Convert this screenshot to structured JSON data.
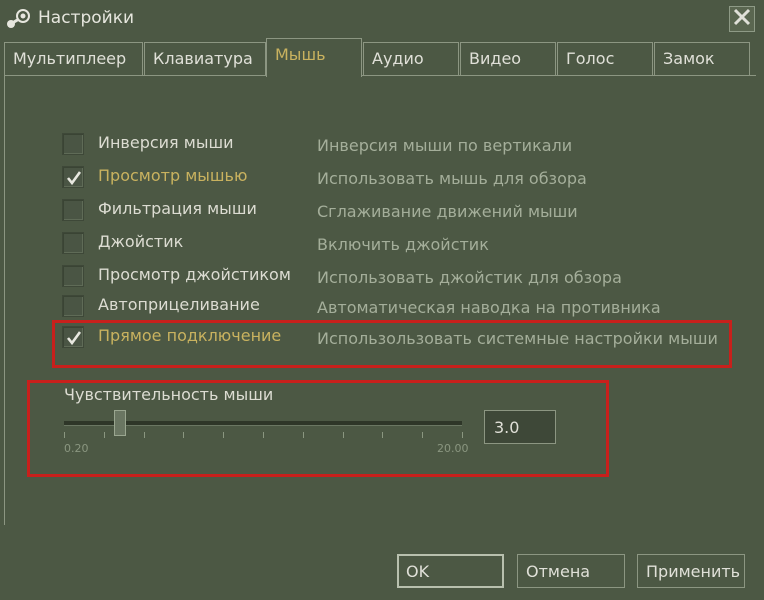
{
  "window": {
    "title": "Настройки",
    "title_icon": "steam-icon",
    "close_icon": "close-icon"
  },
  "tabs": [
    {
      "label": "Мультиплеер",
      "active": false
    },
    {
      "label": "Клавиатура",
      "active": false
    },
    {
      "label": "Мышь",
      "active": true
    },
    {
      "label": "Аудио",
      "active": false
    },
    {
      "label": "Видео",
      "active": false
    },
    {
      "label": "Голос",
      "active": false
    },
    {
      "label": "Замок",
      "active": false
    }
  ],
  "options": [
    {
      "label": "Инверсия мыши",
      "description": "Инверсия мыши по вертикали",
      "checked": false
    },
    {
      "label": "Просмотр мышью",
      "description": "Использовать мышь для обзора",
      "checked": true
    },
    {
      "label": "Фильтрация мыши",
      "description": "Сглаживание движений мыши",
      "checked": false
    },
    {
      "label": "Джойстик",
      "description": "Включить джойстик",
      "checked": false
    },
    {
      "label": "Просмотр джойстиком",
      "description": "Использовать джойстик для обзора",
      "checked": false
    },
    {
      "label": "Автоприцеливание",
      "description": "Автоматическая наводка на противника",
      "checked": false
    },
    {
      "label": "Прямое подключение",
      "description": "Использользовать системные настройки мыши",
      "checked": true
    }
  ],
  "sensitivity": {
    "label": "Чувствительность мыши",
    "min_label": "0.20",
    "max_label": "20.00",
    "min": 0.2,
    "max": 20.0,
    "value": 3.0,
    "value_text": "3.0"
  },
  "buttons": {
    "ok": "OK",
    "cancel": "Отмена",
    "apply": "Применить"
  },
  "colors": {
    "background": "#4c5844",
    "accent_label": "#c9b25f",
    "highlight_box": "#c8201c",
    "description_text": "#a4ae9a"
  }
}
